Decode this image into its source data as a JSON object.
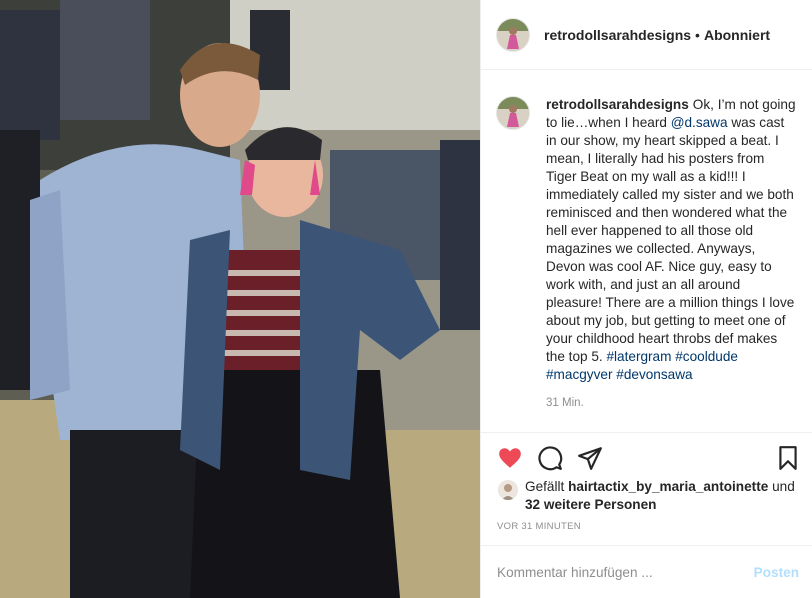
{
  "header": {
    "username": "retrodollsarahdesigns",
    "separator": "•",
    "follow_status": "Abonniert"
  },
  "caption": {
    "username": "retrodollsarahdesigns",
    "text_1": "Ok, I’m not going to lie…when I heard ",
    "mention": "@d.sawa",
    "text_2": " was cast in our show, my heart skipped a beat. I mean, I literally had his posters from Tiger Beat on my wall as a kid!!! I immediately called my sister and we both reminisced and then wondered what the hell ever happened to all those old magazines we collected. Anyways, Devon was cool AF. Nice guy, easy to work with, and just an all around pleasure! There are a million things I love about my job, but getting to meet one of your childhood heart throbs def makes the top 5. ",
    "hashtags": [
      "#latergram",
      "#cooldude",
      "#macgyver",
      "#devonsawa"
    ],
    "time": "31 Min."
  },
  "actions": {
    "like_icon": "heart-filled-icon",
    "comment_icon": "comment-bubble-icon",
    "share_icon": "paper-plane-icon",
    "save_icon": "bookmark-icon",
    "like_color": "#ed4956"
  },
  "likes": {
    "prefix": "Gefällt ",
    "user": "hairtactix_by_maria_antoinette",
    "middle": " und ",
    "others": "32 weitere Personen"
  },
  "post_date": "VOR 31 MINUTEN",
  "comment_box": {
    "placeholder": "Kommentar hinzufügen ...",
    "post_label": "Posten"
  },
  "colors": {
    "link": "#00376b",
    "muted": "#8e8e8e",
    "post_disabled": "#b2dffc"
  }
}
